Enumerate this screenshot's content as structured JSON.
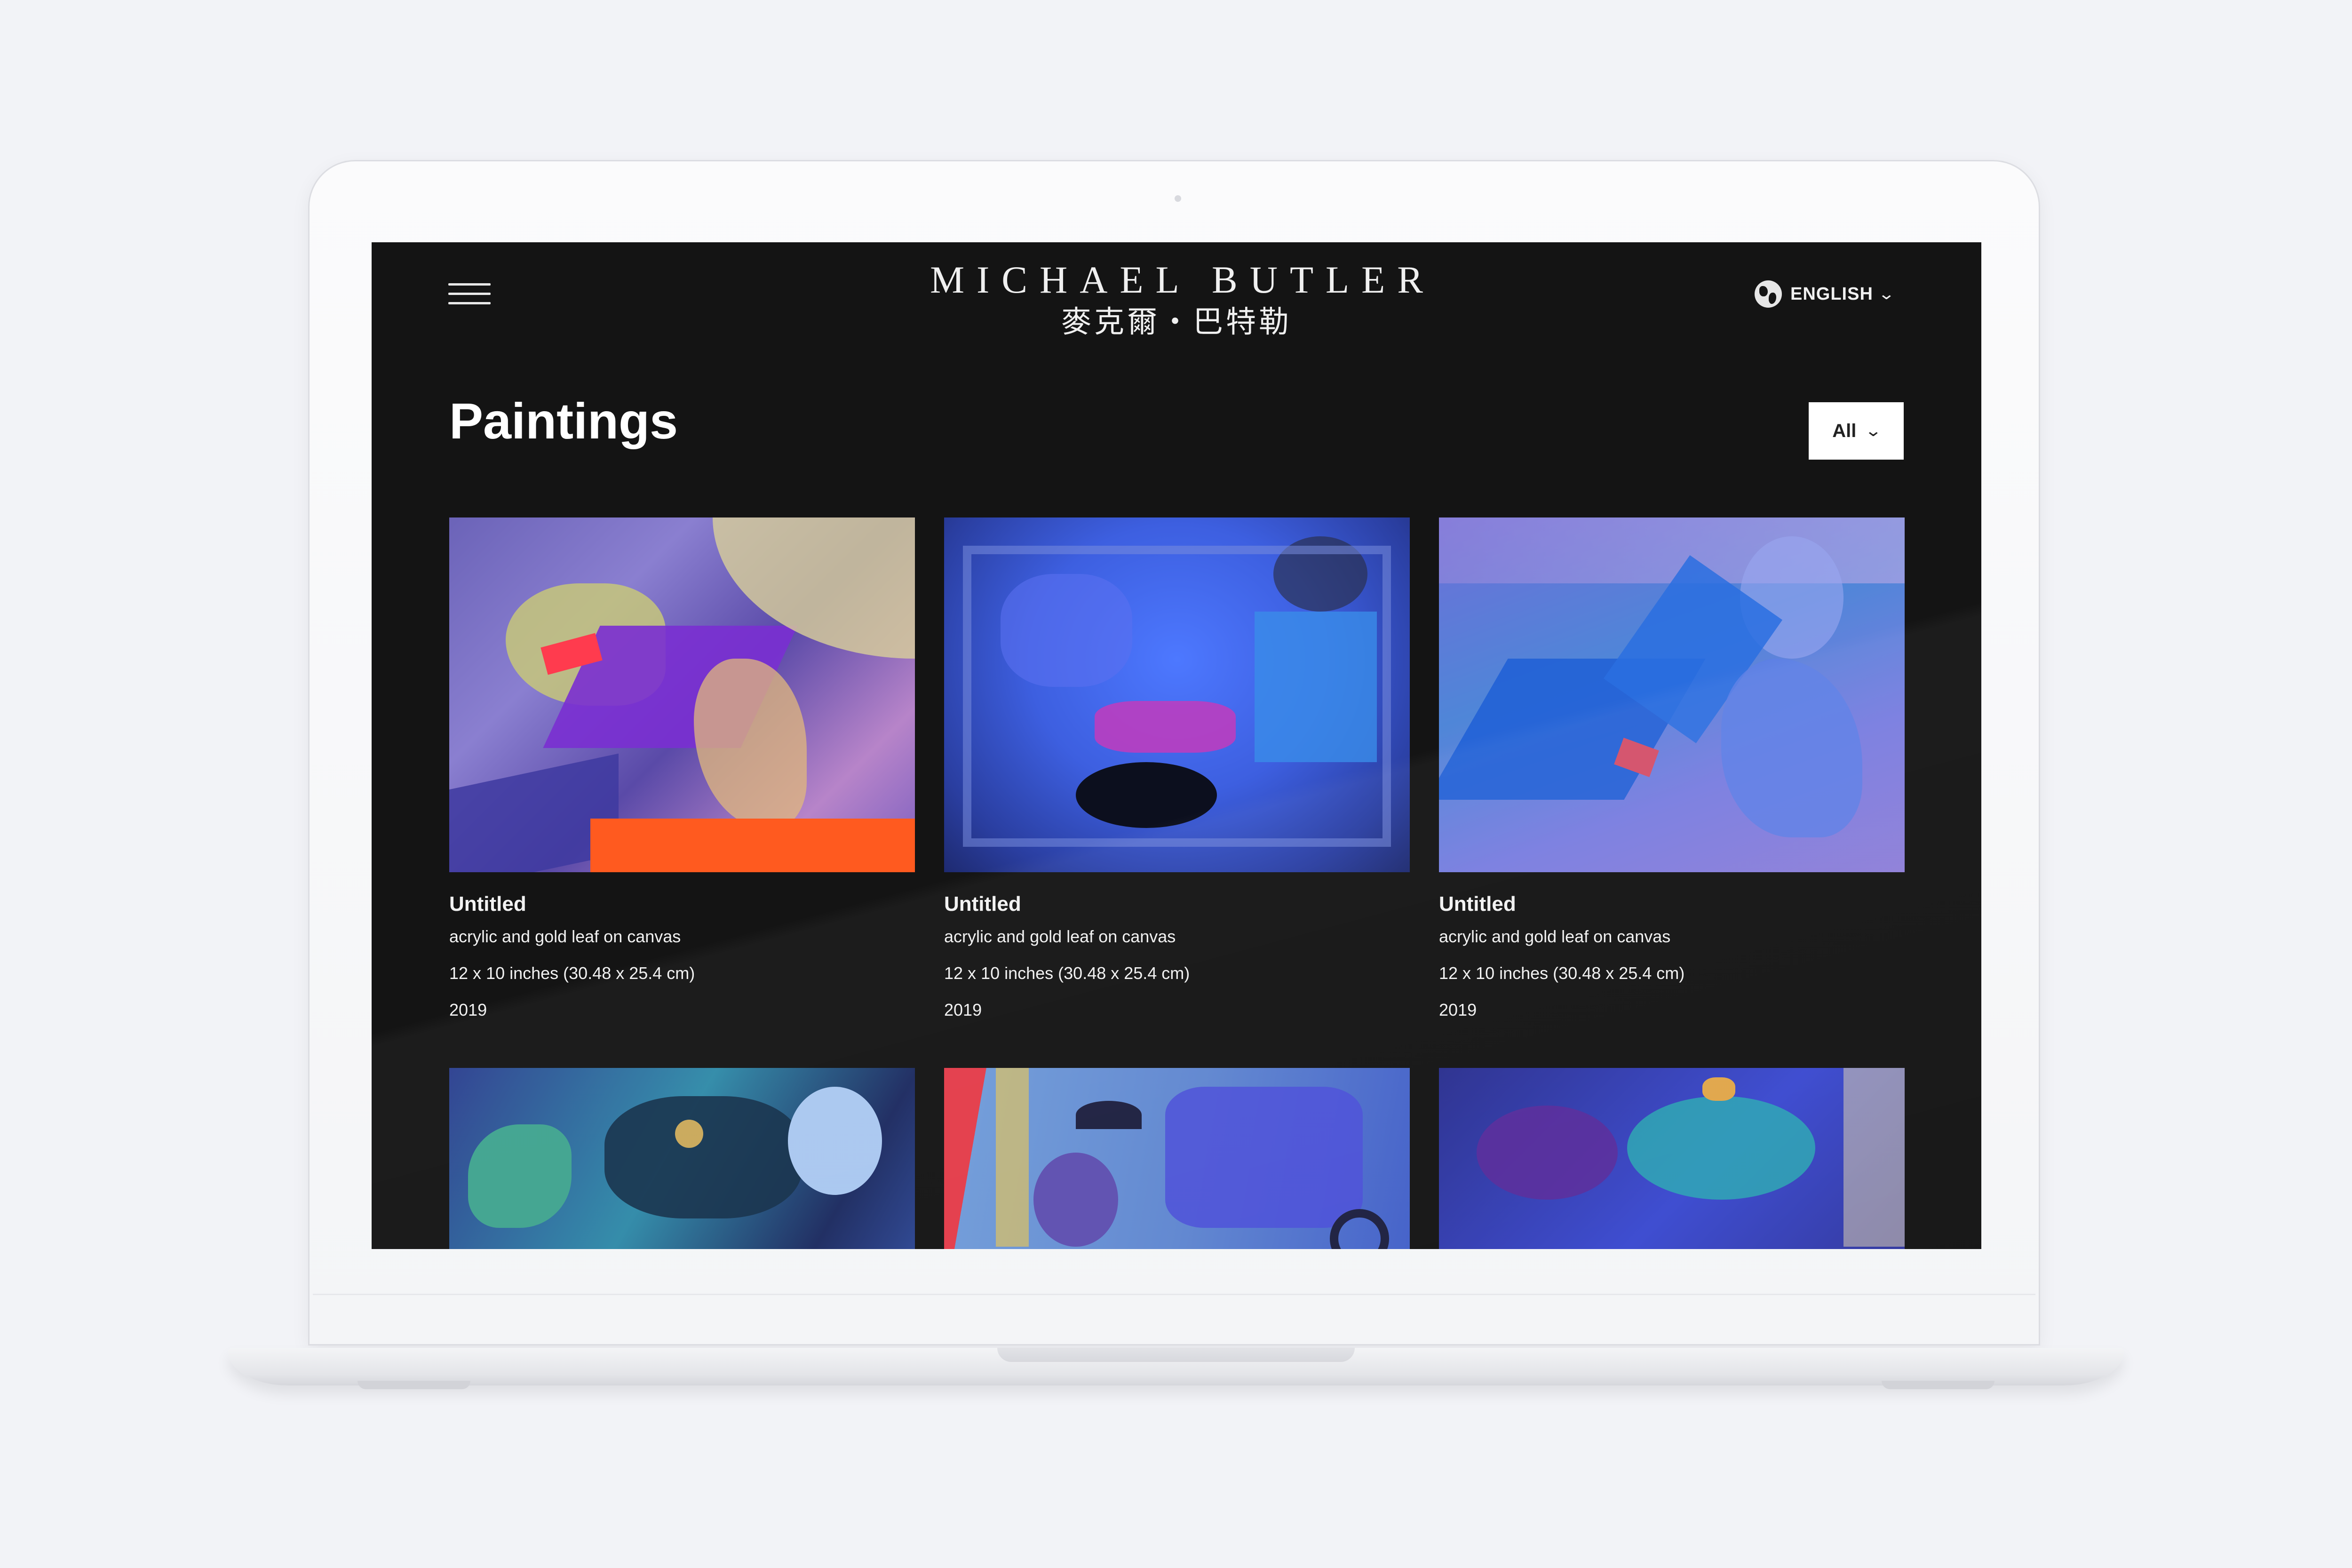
{
  "header": {
    "logo_en": "MICHAEL BUTLER",
    "logo_zh": "麥克爾・巴特勒",
    "language_label": "ENGLISH"
  },
  "page": {
    "title": "Paintings",
    "filter_value": "All"
  },
  "paintings": [
    {
      "title": "Untitled",
      "medium": "acrylic and gold leaf on canvas",
      "size": "12 x 10 inches (30.48 x 25.4 cm)",
      "year": "2019"
    },
    {
      "title": "Untitled",
      "medium": "acrylic and gold leaf on canvas",
      "size": "12 x 10 inches (30.48 x 25.4 cm)",
      "year": "2019"
    },
    {
      "title": "Untitled",
      "medium": "acrylic and gold leaf on canvas",
      "size": "12 x 10 inches (30.48 x 25.4 cm)",
      "year": "2019"
    }
  ],
  "colors": {
    "page_background": "#f2f3f7",
    "screen_background": "#141414",
    "text": "#ffffff",
    "filter_background": "#ffffff"
  },
  "icons": [
    "hamburger-menu-icon",
    "globe-icon",
    "chevron-down-icon"
  ]
}
